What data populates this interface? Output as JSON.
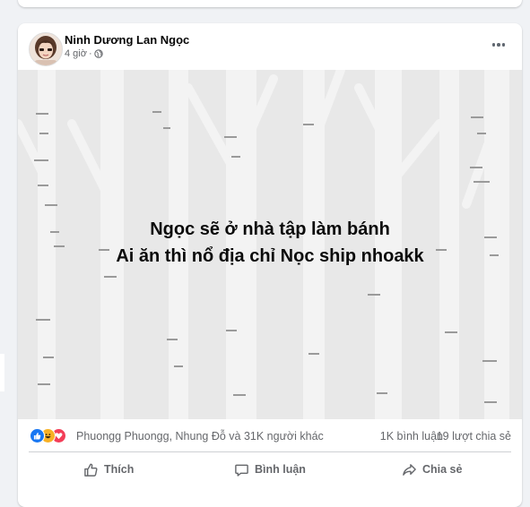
{
  "post": {
    "author": "Ninh Dương Lan Ngọc",
    "time": "4 giờ",
    "privacy_icon": "globe-icon",
    "menu_icon": "more-horizontal-icon",
    "image_text": {
      "line1": "Ngọc sẽ ở nhà tập làm bánh",
      "line2": "Ai ăn thì nổ địa chỉ Nọc ship nhoakk"
    },
    "reactions": {
      "icons": [
        "like-icon",
        "haha-icon",
        "love-icon"
      ],
      "summary": "Phuongg Phuongg, Nhung Đỗ và 31K người khác",
      "comments": "1K bình luận",
      "shares": "19 lượt chia sẻ"
    },
    "actions": {
      "like": "Thích",
      "comment": "Bình luận",
      "share": "Chia sẻ"
    }
  },
  "colors": {
    "like_blue": "#1877f2",
    "love_red": "#f33e58",
    "haha_yellow": "#f7b125",
    "secondary_text": "#65676b"
  }
}
